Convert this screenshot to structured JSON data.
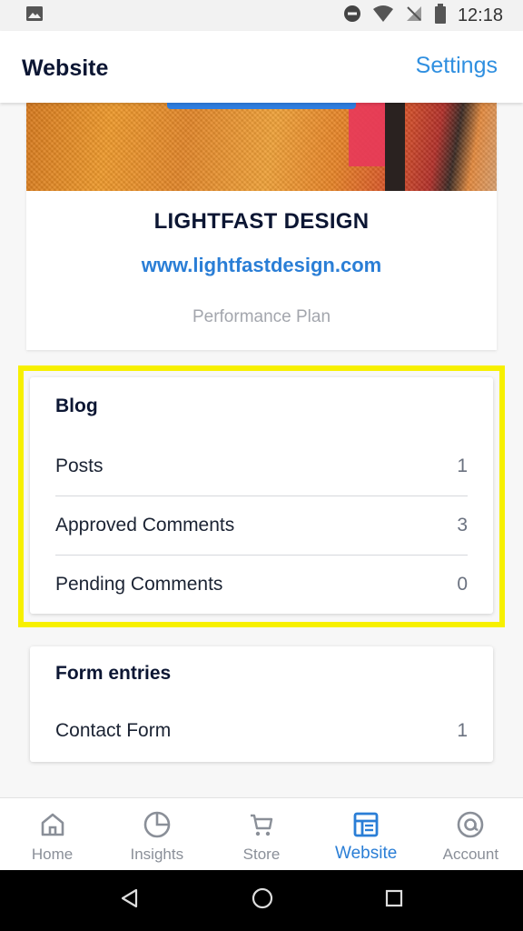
{
  "status_bar": {
    "time": "12:18",
    "icons": [
      "image-icon",
      "dnd-icon",
      "wifi-icon",
      "no-signal-icon",
      "battery-icon"
    ]
  },
  "app_bar": {
    "title": "Website",
    "settings_label": "Settings"
  },
  "site": {
    "name": "LIGHTFAST DESIGN",
    "url": "www.lightfastdesign.com",
    "plan": "Performance Plan"
  },
  "blog": {
    "title": "Blog",
    "rows": [
      {
        "label": "Posts",
        "value": "1"
      },
      {
        "label": "Approved Comments",
        "value": "3"
      },
      {
        "label": "Pending Comments",
        "value": "0"
      }
    ]
  },
  "form_entries": {
    "title": "Form entries",
    "rows": [
      {
        "label": "Contact Form",
        "value": "1"
      }
    ]
  },
  "bottom_nav": {
    "items": [
      {
        "label": "Home",
        "icon": "home-icon"
      },
      {
        "label": "Insights",
        "icon": "pie-chart-icon"
      },
      {
        "label": "Store",
        "icon": "cart-icon"
      },
      {
        "label": "Website",
        "icon": "layout-icon",
        "active": true
      },
      {
        "label": "Account",
        "icon": "account-icon"
      }
    ]
  },
  "colors": {
    "accent": "#2a7ed6",
    "highlight": "#f7f000",
    "title": "#0c1633"
  }
}
